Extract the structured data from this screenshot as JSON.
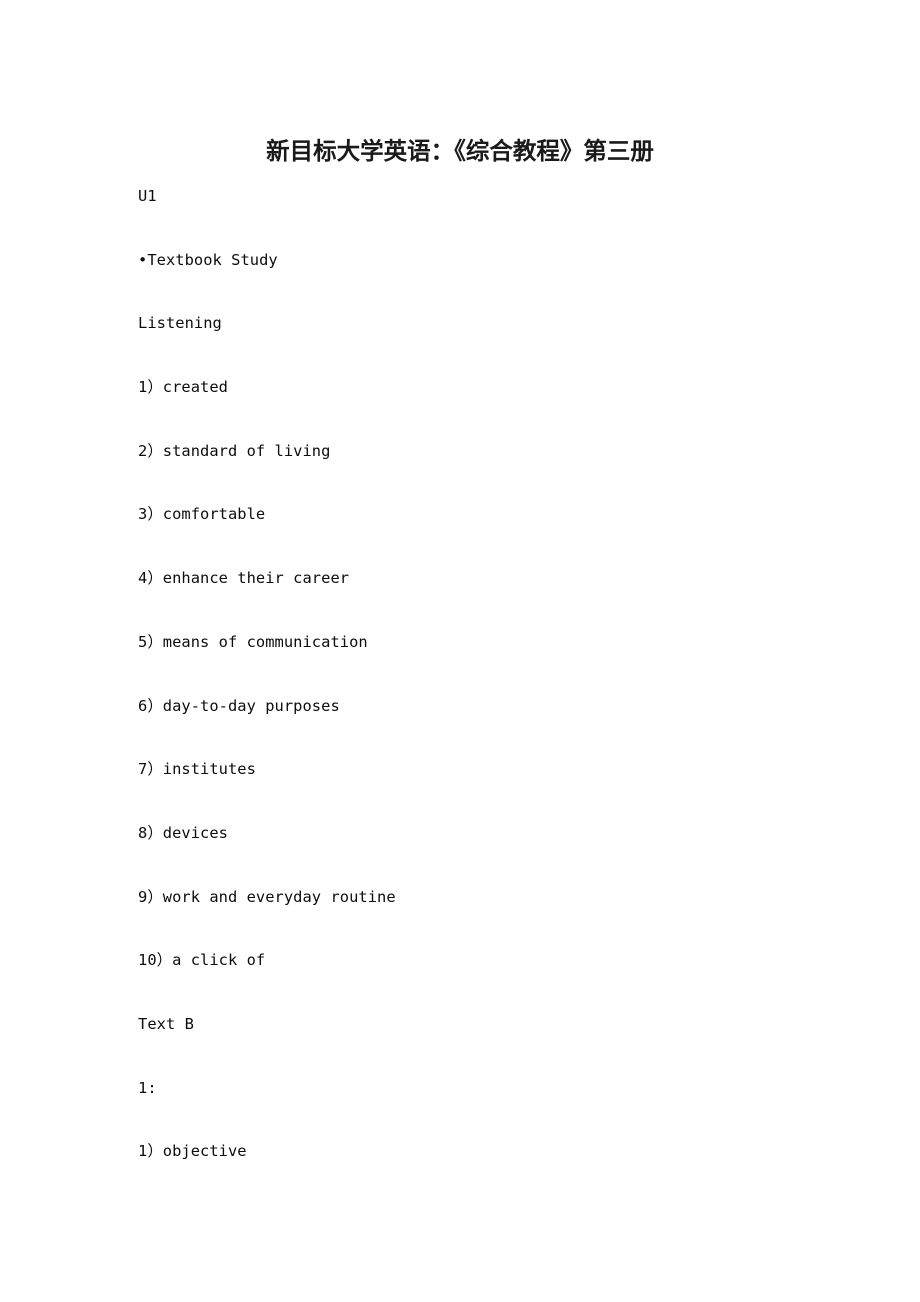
{
  "document": {
    "title": "新目标大学英语：《综合教程》第三册",
    "page_background": "#ffffff",
    "text_color": "#000000",
    "body_lines": [
      {
        "id": "unit-label",
        "text": "U1"
      },
      {
        "id": "section-textbook",
        "text": "•Textbook Study"
      },
      {
        "id": "section-listening",
        "text": "Listening"
      },
      {
        "id": "answer-1",
        "text": "1）created"
      },
      {
        "id": "answer-2",
        "text": "2）standard of living"
      },
      {
        "id": "answer-3",
        "text": "3）comfortable"
      },
      {
        "id": "answer-4",
        "text": "4）enhance their career"
      },
      {
        "id": "answer-5",
        "text": "5）means of communication"
      },
      {
        "id": "answer-6",
        "text": "6）day-to-day purposes"
      },
      {
        "id": "answer-7",
        "text": "7）institutes"
      },
      {
        "id": "answer-8",
        "text": "8）devices"
      },
      {
        "id": "answer-9",
        "text": "9）work and everyday routine"
      },
      {
        "id": "answer-10",
        "text": "10）a click of"
      },
      {
        "id": "section-text-b",
        "text": "Text B"
      },
      {
        "id": "exercise-1-label",
        "text": "1:"
      },
      {
        "id": "exercise-1-item-1",
        "text": "1）objective"
      }
    ]
  }
}
